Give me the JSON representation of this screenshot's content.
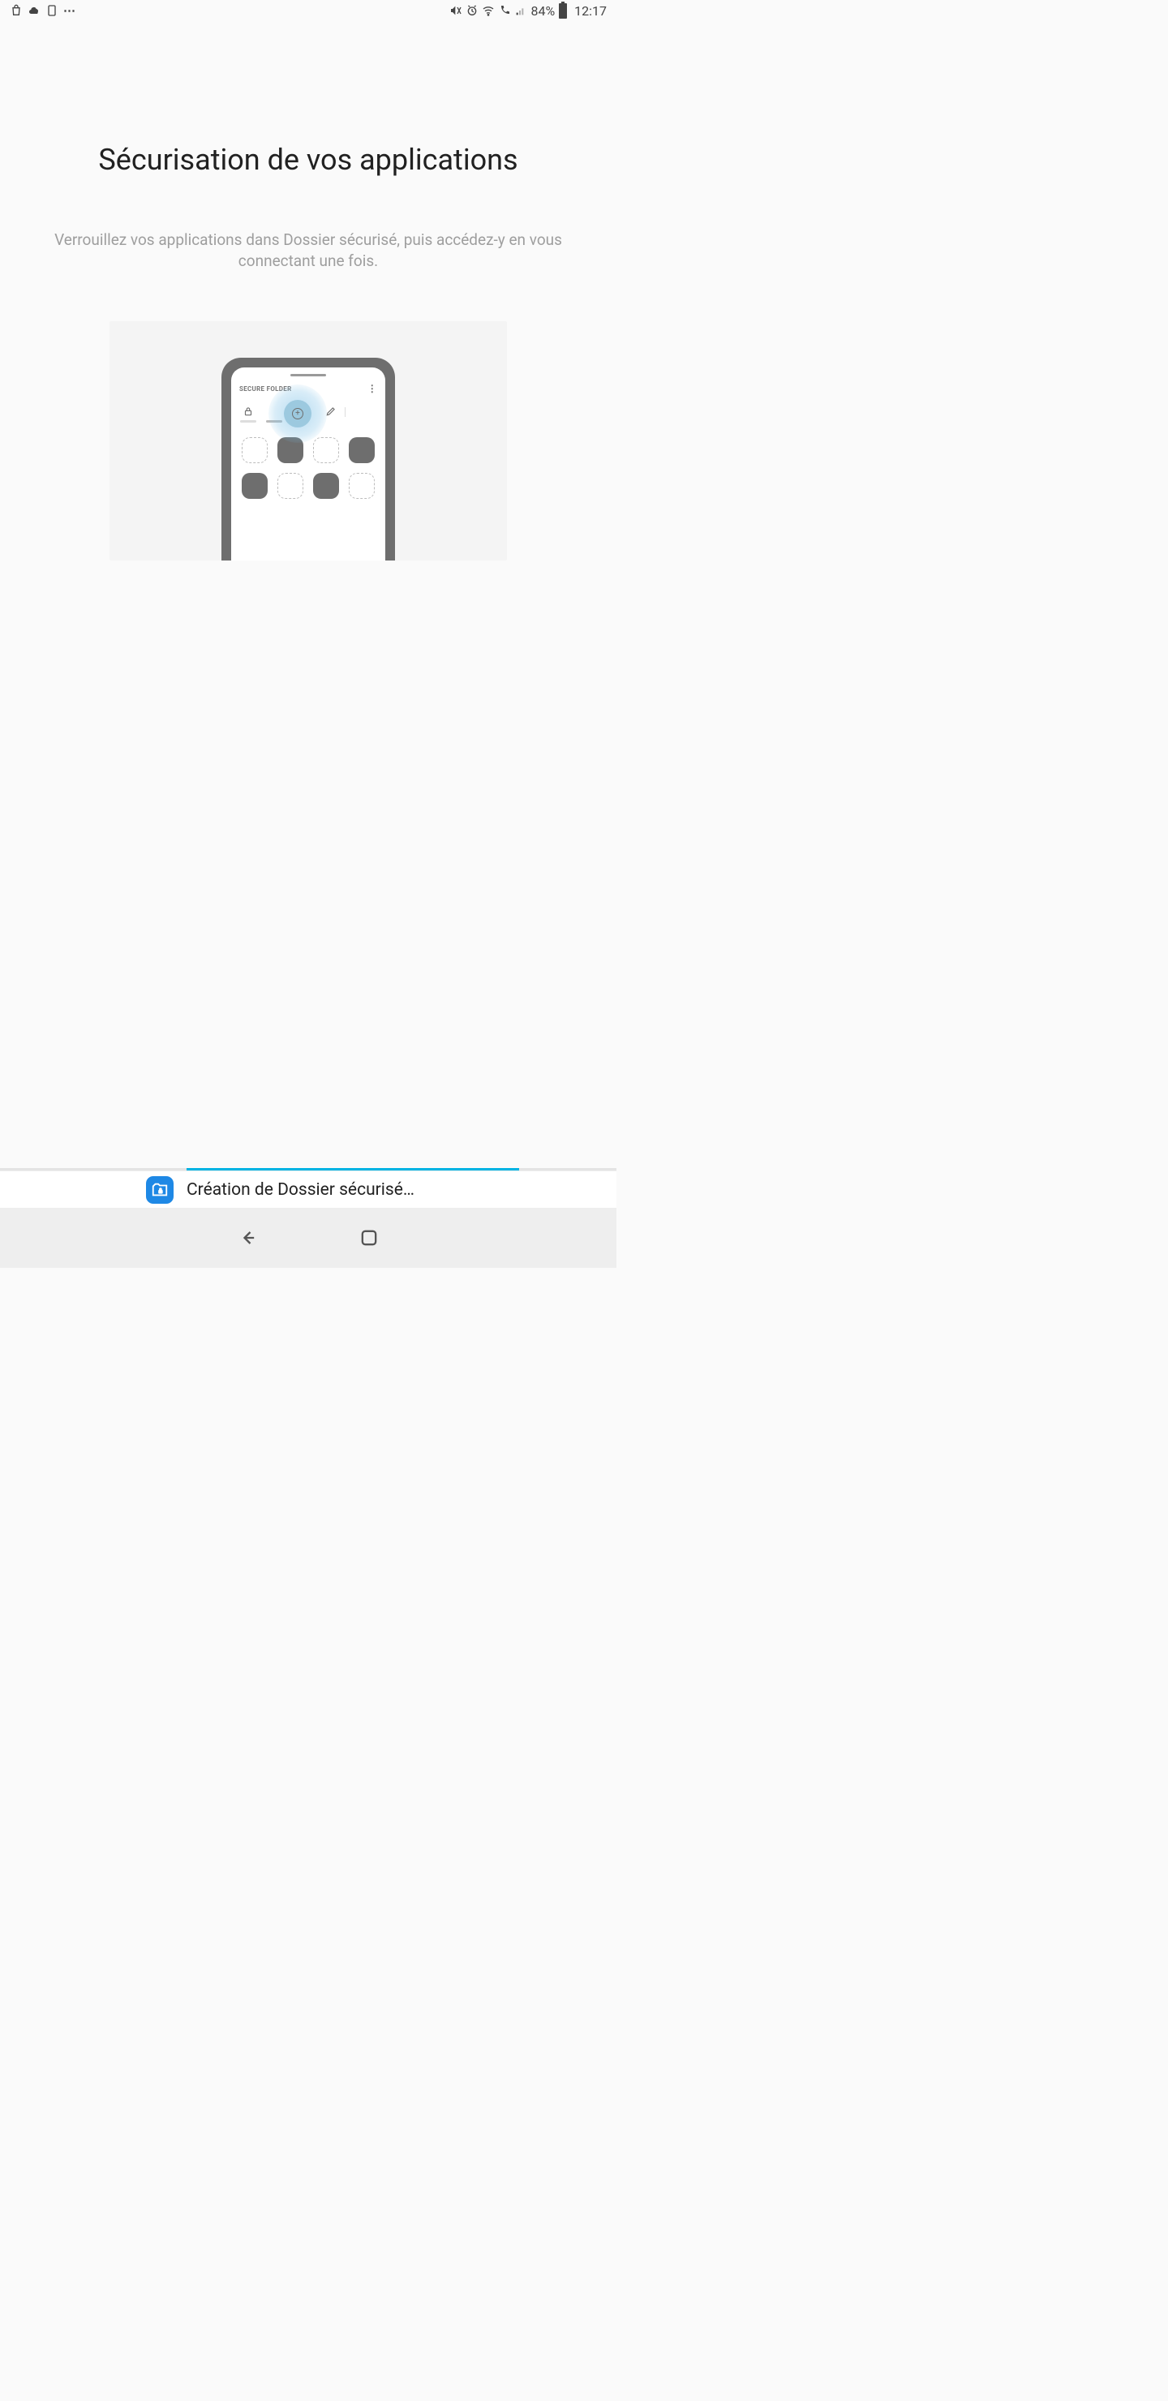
{
  "status_bar": {
    "battery_percent": "84%",
    "time": "12:17",
    "dots": "⋯"
  },
  "page": {
    "title": "Sécurisation de vos applications",
    "subtitle": "Verrouillez vos applications dans Dossier sécurisé, puis accédez-y en vous connectant une fois.",
    "illustration_header": "SECURE FOLDER",
    "illustration_more": "⋮"
  },
  "footer": {
    "status_text": "Création de Dossier sécurisé…"
  },
  "progress": {
    "percent": 55
  },
  "colors": {
    "accent": "#00b3e3",
    "folder_icon_bg": "#1e88e5"
  }
}
